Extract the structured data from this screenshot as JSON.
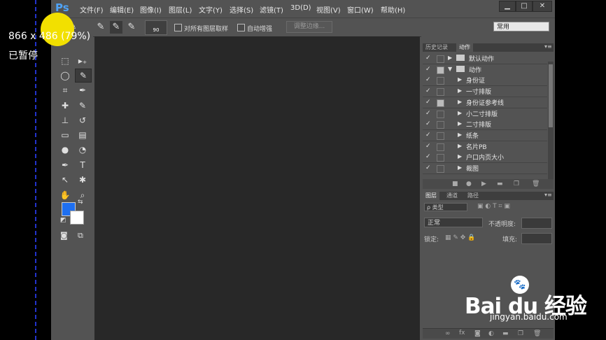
{
  "overlay": {
    "size_text": "866 x 486 (79%)",
    "status_text": "已暂停"
  },
  "app": {
    "logo": "Ps"
  },
  "menu": [
    "文件(F)",
    "编辑(E)",
    "图像(I)",
    "图层(L)",
    "文字(Y)",
    "选择(S)",
    "滤镜(T)",
    "3D(D)",
    "视图(V)",
    "窗口(W)",
    "帮助(H)"
  ],
  "window_controls": {
    "minimize": "▁",
    "maximize": "□",
    "close": "✕"
  },
  "options_bar": {
    "brush_size": "90",
    "sample_all_layers": "对所有图层取样",
    "auto_enhance": "自动增强",
    "refine_edge": "调整边缘...",
    "workspace": "常用"
  },
  "tools": [
    {
      "name": "move-tool",
      "glyph": "▸✥"
    },
    {
      "name": "marquee-tool",
      "glyph": "⬚"
    },
    {
      "name": "artboard-tool",
      "glyph": "▸₊"
    },
    {
      "name": "lasso-tool",
      "glyph": "◯"
    },
    {
      "name": "quick-selection-tool",
      "glyph": "✎"
    },
    {
      "name": "crop-tool",
      "glyph": "⌗"
    },
    {
      "name": "eyedropper-tool",
      "glyph": "✒"
    },
    {
      "name": "healing-brush-tool",
      "glyph": "✚"
    },
    {
      "name": "brush-tool",
      "glyph": "✎"
    },
    {
      "name": "clone-stamp-tool",
      "glyph": "⊥"
    },
    {
      "name": "history-brush-tool",
      "glyph": "↺"
    },
    {
      "name": "eraser-tool",
      "glyph": "▭"
    },
    {
      "name": "gradient-tool",
      "glyph": "▤"
    },
    {
      "name": "blur-tool",
      "glyph": "●"
    },
    {
      "name": "dodge-tool",
      "glyph": "◔"
    },
    {
      "name": "pen-tool",
      "glyph": "✒"
    },
    {
      "name": "type-tool",
      "glyph": "T"
    },
    {
      "name": "path-selection-tool",
      "glyph": "↖"
    },
    {
      "name": "shape-tool",
      "glyph": "✱"
    },
    {
      "name": "hand-tool",
      "glyph": "✋"
    },
    {
      "name": "zoom-tool",
      "glyph": "🔍"
    }
  ],
  "colors": {
    "foreground": "#1e6ff0",
    "background": "#ffffff"
  },
  "history_panel": {
    "tabs": [
      "历史记录",
      "动作"
    ],
    "actions": [
      {
        "label": "默认动作",
        "dialog": false,
        "level": 0,
        "expanded": false
      },
      {
        "label": "动作",
        "dialog": true,
        "level": 0,
        "expanded": true
      },
      {
        "label": "身份证",
        "dialog": false,
        "level": 1
      },
      {
        "label": "一寸排版",
        "dialog": false,
        "level": 1
      },
      {
        "label": "身份证参考线",
        "dialog": true,
        "level": 1
      },
      {
        "label": "小二寸排版",
        "dialog": false,
        "level": 1
      },
      {
        "label": "二寸排版",
        "dialog": false,
        "level": 1
      },
      {
        "label": "纸条",
        "dialog": false,
        "level": 1
      },
      {
        "label": "名片PB",
        "dialog": false,
        "level": 1
      },
      {
        "label": "户口内页大小",
        "dialog": false,
        "level": 1
      },
      {
        "label": "裁图",
        "dialog": false,
        "level": 1
      }
    ]
  },
  "layers_panel": {
    "tabs": [
      "图层",
      "通道",
      "路径"
    ],
    "filter_label": "ρ 类型",
    "blend_mode": "正常",
    "opacity_label": "不透明度:",
    "lock_label": "锁定:",
    "fill_label": "填充:"
  },
  "watermark": {
    "brand": "Bai du 经验",
    "url": "jingyan.baidu.com"
  }
}
